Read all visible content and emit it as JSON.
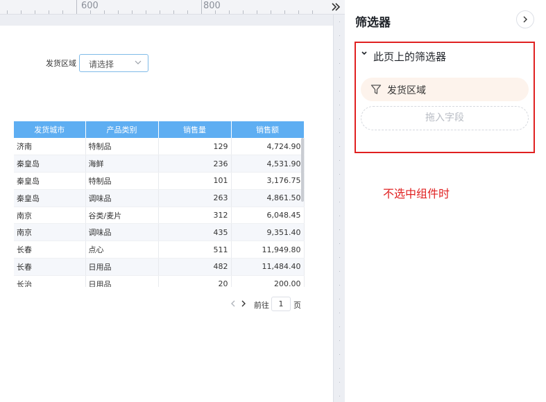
{
  "ruler": {
    "labels": [
      "600",
      "800"
    ]
  },
  "report": {
    "filter_label": "发货区域",
    "filter_placeholder": "请选择",
    "table": {
      "headers": [
        "发货城市",
        "产品类别",
        "销售量",
        "销售额"
      ],
      "rows": [
        [
          "济南",
          "特制品",
          "129",
          "4,724.90"
        ],
        [
          "秦皇岛",
          "海鲜",
          "236",
          "4,531.90"
        ],
        [
          "秦皇岛",
          "特制品",
          "101",
          "3,176.75"
        ],
        [
          "秦皇岛",
          "调味品",
          "263",
          "4,861.50"
        ],
        [
          "南京",
          "谷类/麦片",
          "312",
          "6,048.45"
        ],
        [
          "南京",
          "调味品",
          "435",
          "9,351.40"
        ],
        [
          "长春",
          "点心",
          "511",
          "11,949.80"
        ],
        [
          "长春",
          "日用品",
          "482",
          "11,484.40"
        ],
        [
          "长治",
          "日用品",
          "20",
          "200.00"
        ]
      ]
    },
    "pagination": {
      "goto_label": "前往",
      "page": "1",
      "page_unit": "页"
    }
  },
  "panel": {
    "title": "筛选器",
    "section_title": "此页上的筛选器",
    "filters": [
      "发货区域"
    ],
    "drop_zone_label": "拖入字段",
    "annotation": "不选中组件时"
  },
  "colors": {
    "header": "#5eaef2",
    "highlight": "#e02020",
    "chip": "#fdf3ec"
  }
}
